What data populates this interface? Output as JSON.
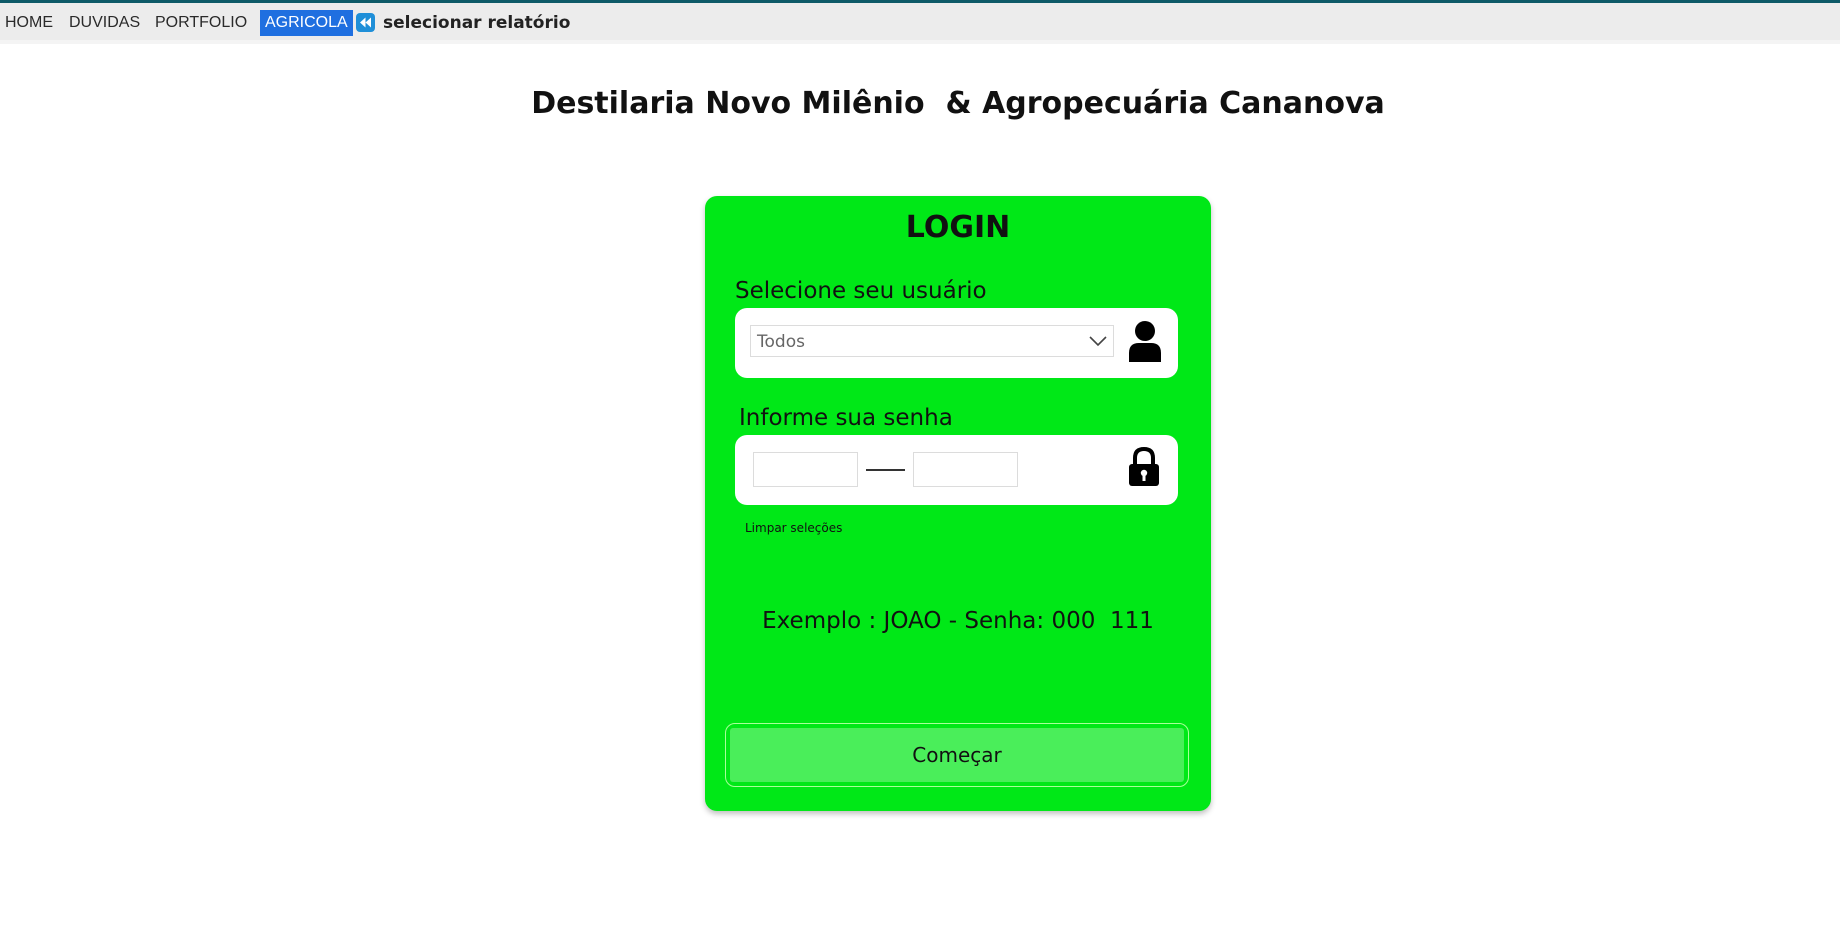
{
  "nav": {
    "items": [
      {
        "label": "HOME"
      },
      {
        "label": "DUVIDAS"
      },
      {
        "label": "PORTFOLIO"
      },
      {
        "label": "AGRICOLA",
        "active": true
      }
    ],
    "back_icon": "rewind-icon",
    "report_label": "selecionar relatório"
  },
  "page": {
    "title": "Destilaria Novo Milênio  & Agropecuária Cananova"
  },
  "login": {
    "title": "LOGIN",
    "user_label": "Selecione seu usuário",
    "user_select_value": "Todos",
    "user_icon": "user-icon",
    "password_label": "Informe sua senha",
    "password_part1": "",
    "password_part2": "",
    "lock_icon": "lock-icon",
    "clear_label": "Limpar seleções",
    "example_text": "Exemplo : JOAO - Senha: 000  111",
    "start_label": "Começar"
  },
  "colors": {
    "accent_nav": "#1f6fe0",
    "card_green": "#00e817",
    "button_green": "#4aee5a",
    "topbar_border": "#0e5a68"
  }
}
